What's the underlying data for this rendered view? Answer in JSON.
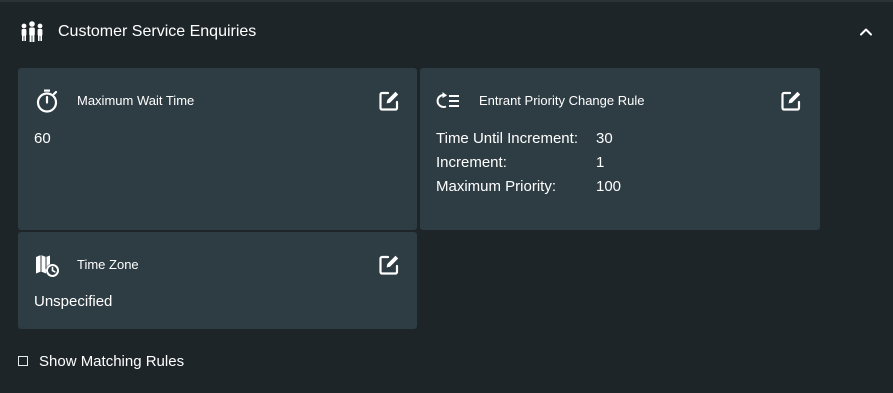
{
  "header": {
    "title": "Customer Service Enquiries",
    "icon": "people-group-icon",
    "collapse_icon": "chevron-up-icon"
  },
  "cards": {
    "max_wait": {
      "title": "Maximum Wait Time",
      "icon": "stopwatch-icon",
      "value": "60"
    },
    "priority_rule": {
      "title": "Entrant Priority Change Rule",
      "icon": "priority-list-icon",
      "rows": [
        {
          "label": "Time Until Increment:",
          "value": "30"
        },
        {
          "label": "Increment:",
          "value": "1"
        },
        {
          "label": "Maximum Priority:",
          "value": "100"
        }
      ]
    },
    "time_zone": {
      "title": "Time Zone",
      "icon": "map-clock-icon",
      "value": "Unspecified"
    }
  },
  "show_matching_rules": {
    "label": "Show Matching Rules",
    "checked": false
  },
  "colors": {
    "background": "#1e2528",
    "card": "#2e3c43",
    "text": "#ffffff"
  }
}
